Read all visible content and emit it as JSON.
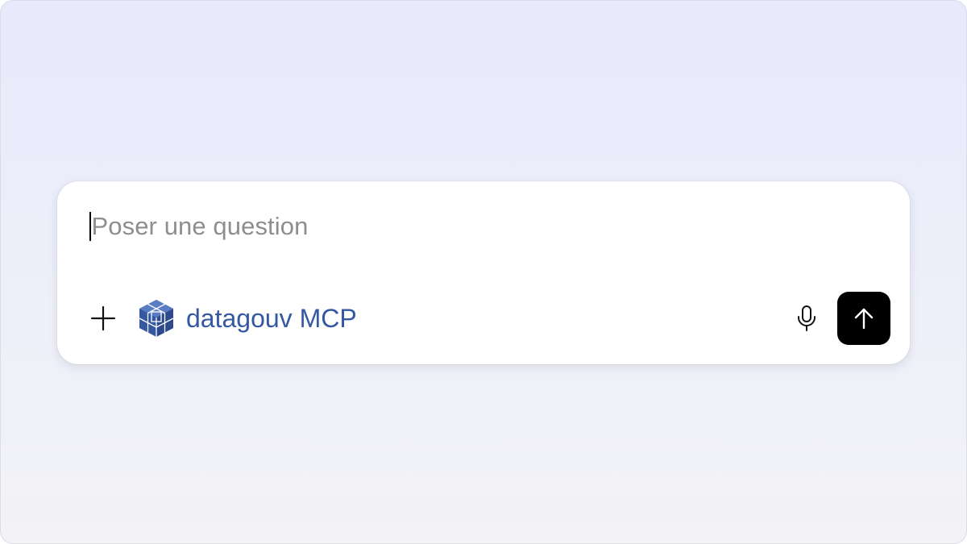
{
  "composer": {
    "placeholder": "Poser une question",
    "input_value": ""
  },
  "toolbar": {
    "add_icon": "plus-icon",
    "tool": {
      "label": "datagouv MCP",
      "icon": "datagouv-cube-logo",
      "color": "#3558a2"
    },
    "mic_icon": "microphone-icon",
    "send_icon": "arrow-up-icon",
    "send_button_color": "#000000"
  },
  "colors": {
    "background_top": "#e8eafc",
    "background_bottom": "#f3f3f6",
    "placeholder_text": "#8e8e8e"
  }
}
